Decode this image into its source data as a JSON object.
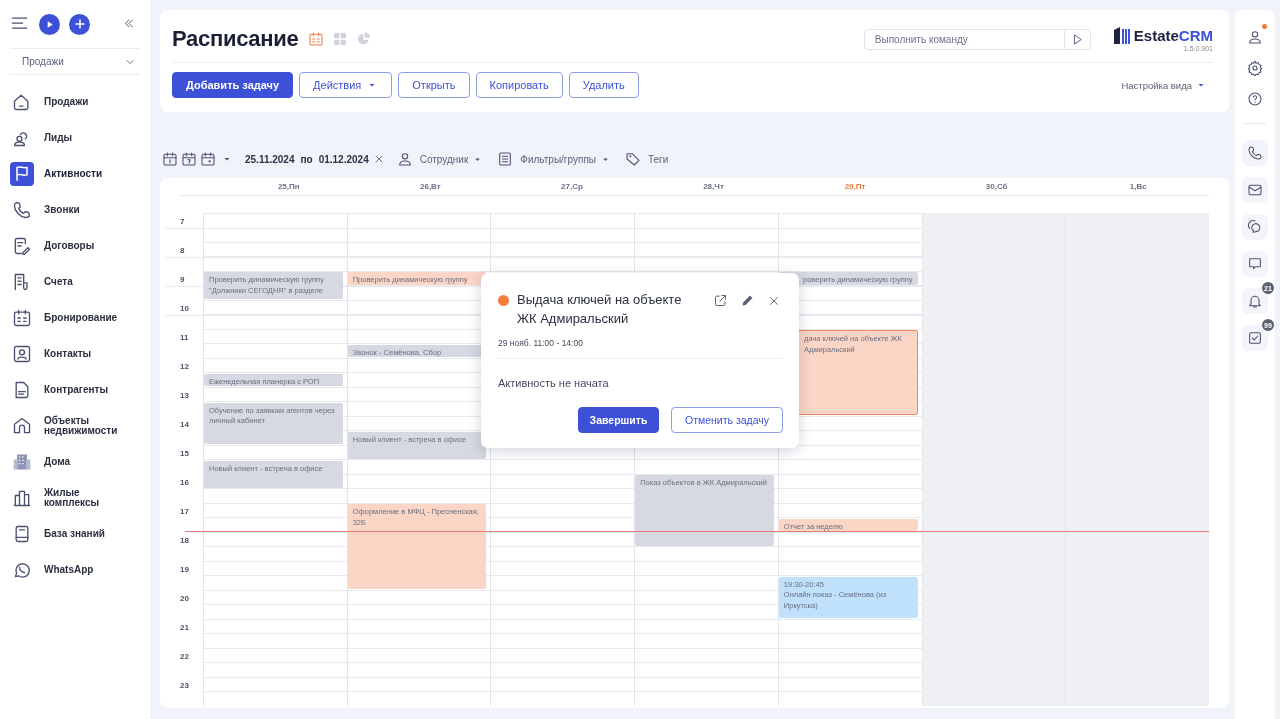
{
  "sidebar": {
    "top_buttons": [
      {
        "kind": "menu"
      },
      {
        "kind": "play"
      },
      {
        "kind": "plus"
      },
      {
        "kind": "collapse"
      }
    ],
    "section_select": {
      "value": "Продажи"
    },
    "items": [
      {
        "label": "Продажи",
        "kind": "home",
        "selected": false
      },
      {
        "label": "Лиды",
        "kind": "users",
        "selected": false
      },
      {
        "label": "Активности",
        "kind": "flag",
        "selected": true
      },
      {
        "label": "Звонки",
        "kind": "phone",
        "selected": false
      },
      {
        "label": "Договоры",
        "kind": "doc",
        "selected": false
      },
      {
        "label": "Счета",
        "kind": "receipt",
        "selected": false
      },
      {
        "label": "Бронирование",
        "kind": "calendar",
        "selected": false
      },
      {
        "label": "Контакты",
        "kind": "contact",
        "selected": false
      },
      {
        "label": "Контрагенты",
        "kind": "file",
        "selected": false
      },
      {
        "label": "Объекты недвижимости",
        "kind": "house",
        "selected": false
      },
      {
        "label": "Дома",
        "kind": "building",
        "selected": false
      },
      {
        "label": "Жилые комплексы",
        "kind": "complex",
        "selected": false
      },
      {
        "label": "База знаний",
        "kind": "book",
        "selected": false
      },
      {
        "label": "WhatsApp",
        "kind": "whatsapp",
        "selected": false
      }
    ]
  },
  "header": {
    "title": "Расписание",
    "views": [
      {
        "kind": "calendar",
        "selected": true
      },
      {
        "kind": "grid",
        "selected": false
      },
      {
        "kind": "pie",
        "selected": false
      }
    ],
    "command": {
      "placeholder": "Выполнить команду"
    },
    "logo": {
      "part_1": "Estate",
      "part_2": "CRM",
      "version": "1.5.0.901"
    },
    "buttons": [
      {
        "label": "Добавить задачу",
        "kind": "primary"
      },
      {
        "label": "Действия",
        "kind": "dropdown"
      },
      {
        "label": "Открыть",
        "kind": "outline"
      },
      {
        "label": "Копировать",
        "kind": "outline"
      },
      {
        "label": "Удалить",
        "kind": "outline"
      }
    ],
    "view_settings": "Настройка вида"
  },
  "filters": {
    "periods": [
      {
        "kind": "day"
      },
      {
        "kind": "week"
      },
      {
        "kind": "month"
      }
    ],
    "date_from": "25.11.2024",
    "date_sep": "по",
    "date_to": "01.12.2024",
    "employee": "Сотрудник",
    "groups": "Фильтры/группы",
    "tags": "Теги"
  },
  "calendar": {
    "days": [
      {
        "label": "25,Пн",
        "today": false,
        "weekend": false,
        "events": [
          {
            "title": "Проверить динамическую группу \"Должники СЕГОДНЯ\" в разделе",
            "color": "#d6d9e1",
            "selected": false
          },
          {
            "title": "Еженедельная планерка с РОП",
            "color": "#d6d9e1",
            "selected": false
          },
          {
            "title": "Обучение по заявкам агентов через личный кабинет",
            "color": "#d6d9e1",
            "selected": false
          },
          {
            "title": "Новый клиент - встреча в офисе",
            "color": "#d6d9e1",
            "selected": false
          }
        ]
      },
      {
        "label": "26,Вт",
        "today": false,
        "weekend": false,
        "events": [
          {
            "title": "Проверить динамическую группу",
            "color": "#fbd5c5",
            "selected": false
          },
          {
            "title": "Звонок - Семёнова. Сбор",
            "color": "#d6d9e1",
            "selected": false
          },
          {
            "title": "Новый клиент - встреча в офисе",
            "color": "#d6d9e1",
            "selected": false
          },
          {
            "title": "Оформление в МФЦ - Пресненская, 32Б",
            "color": "#fbd5c5",
            "selected": false
          }
        ]
      },
      {
        "label": "27,Ср",
        "today": false,
        "weekend": false
      },
      {
        "label": "28,Чт",
        "today": false,
        "weekend": false,
        "events": [
          {
            "title": "Показ объектов в ЖК Адмиральский",
            "color": "#d6d9e1",
            "selected": false
          }
        ]
      },
      {
        "label": "29,Пт",
        "today": true,
        "weekend": false,
        "events": [
          {
            "title": "роверить динамическую группу",
            "color": "#d6d9e1",
            "selected": false
          },
          {
            "title": "дача ключей на объекте ЖК Адмиральский",
            "color": "#fbd5c5",
            "selected": true
          },
          {
            "title": "Отчет за неделю",
            "color": "#fbd5c5",
            "selected": false
          },
          {
            "time": "19:30-20:45",
            "title": "Онлайн показ - Семёнова (из Иркутска)",
            "color": "#bfe1fb",
            "selected": false
          }
        ]
      },
      {
        "label": "30,Сб",
        "today": false,
        "weekend": true
      },
      {
        "label": "1,Вс",
        "today": false,
        "weekend": true
      }
    ],
    "hours": [
      "7",
      "8",
      "9",
      "10",
      "11",
      "12",
      "13",
      "14",
      "15",
      "16",
      "17",
      "18",
      "19",
      "20",
      "21",
      "22",
      "23"
    ],
    "popup": {
      "color": "#f47c3c",
      "title": "Выдача ключей на объекте ЖК Адмиральский",
      "when": "29 нояб. 11:00 - 14:00",
      "status": "Активность не начата",
      "buttons": [
        {
          "label": "Завершить",
          "kind": "primary"
        },
        {
          "label": "Отменить задачу",
          "kind": "outline"
        }
      ]
    }
  },
  "right_rail": {
    "items": [
      {
        "kind": "user",
        "dot": true
      },
      {
        "kind": "gear"
      },
      {
        "kind": "help"
      },
      {
        "kind": "divider"
      },
      {
        "kind": "phone"
      },
      {
        "kind": "mail"
      },
      {
        "kind": "chat"
      },
      {
        "kind": "message"
      },
      {
        "kind": "bell",
        "badge": "21"
      },
      {
        "kind": "task",
        "badge": "99"
      }
    ]
  }
}
